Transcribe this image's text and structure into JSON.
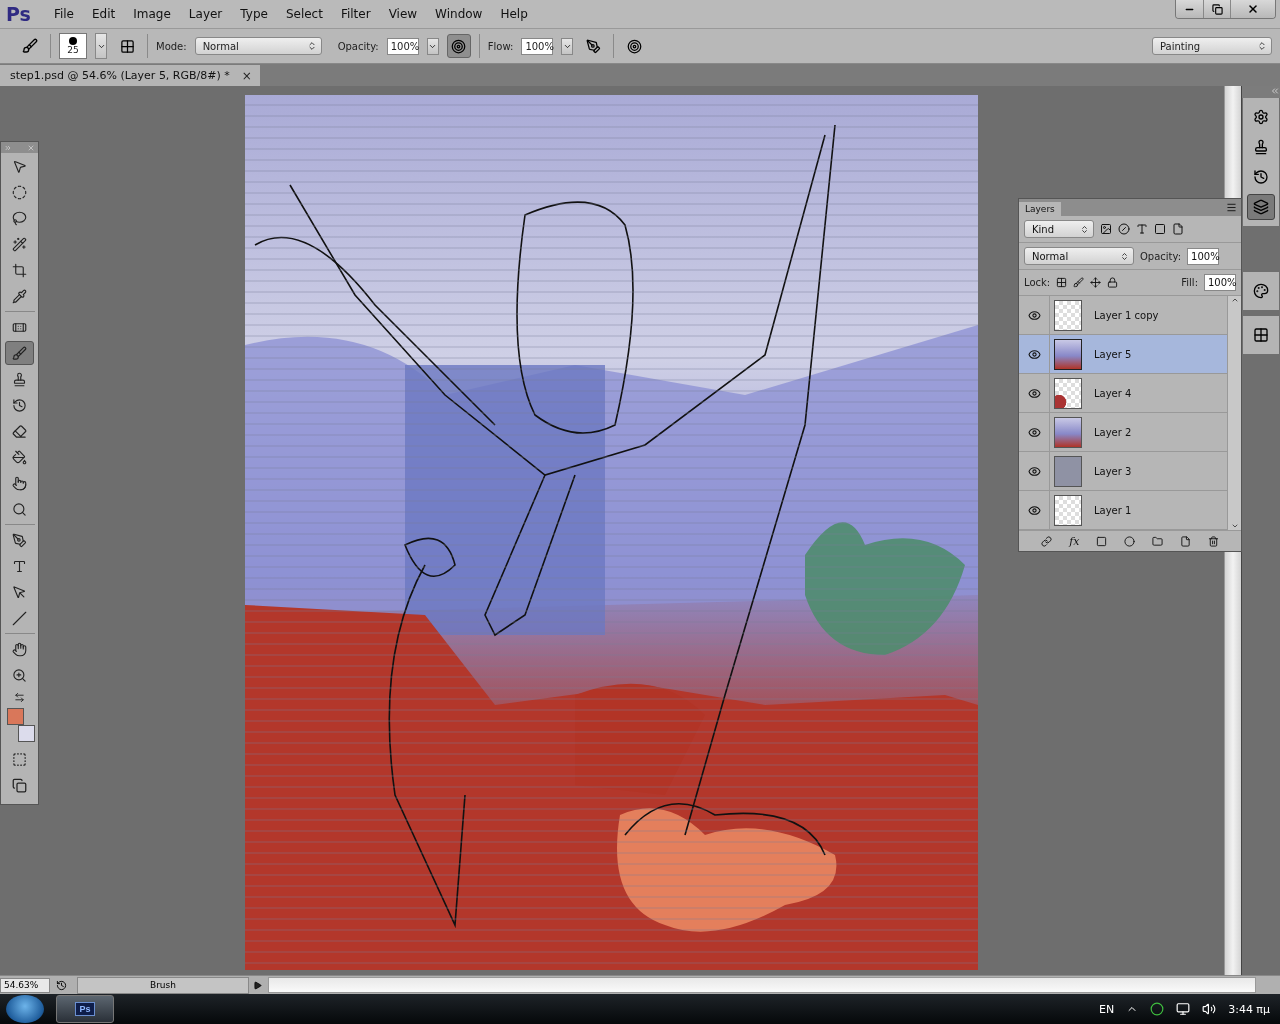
{
  "app": {
    "logo": "Ps"
  },
  "menu": [
    "File",
    "Edit",
    "Image",
    "Layer",
    "Type",
    "Select",
    "Filter",
    "View",
    "Window",
    "Help"
  ],
  "options_bar": {
    "brush_size": "25",
    "mode_label": "Mode:",
    "mode": "Normal",
    "opacity_label": "Opacity:",
    "opacity": "100%",
    "airbrush_on": true,
    "flow_label": "Flow:",
    "flow": "100%",
    "workspace": "Painting"
  },
  "document_tab": {
    "title": "step1.psd @ 54.6% (Layer 5, RGB/8#) *",
    "close": "×"
  },
  "tool_groups": [
    [
      {
        "kind": "move",
        "selected": false
      },
      {
        "kind": "marquee",
        "selected": false
      },
      {
        "kind": "lasso",
        "selected": false
      },
      {
        "kind": "wand",
        "selected": false
      },
      {
        "kind": "crop",
        "selected": false
      },
      {
        "kind": "eyedropper",
        "selected": false
      }
    ],
    [
      {
        "kind": "healing",
        "selected": false
      },
      {
        "kind": "brush",
        "selected": true
      },
      {
        "kind": "stamp",
        "selected": false
      },
      {
        "kind": "history",
        "selected": false
      },
      {
        "kind": "eraser",
        "selected": false
      },
      {
        "kind": "bucket",
        "selected": false
      },
      {
        "kind": "smudge",
        "selected": false
      },
      {
        "kind": "dodge",
        "selected": false
      }
    ],
    [
      {
        "kind": "pen",
        "selected": false
      },
      {
        "kind": "type",
        "selected": false
      },
      {
        "kind": "path",
        "selected": false
      },
      {
        "kind": "line",
        "selected": false
      }
    ],
    [
      {
        "kind": "hand",
        "selected": false
      },
      {
        "kind": "zoom",
        "selected": false
      }
    ]
  ],
  "layers_panel": {
    "title": "Layers",
    "filter": "Kind",
    "blend_mode": "Normal",
    "opacity_label": "Opacity:",
    "opacity": "100%",
    "lock_label": "Lock:",
    "fill_label": "Fill:",
    "fill": "100%",
    "fx": "fx",
    "layers": [
      {
        "name": "Layer 1 copy",
        "visible": true,
        "selected": false,
        "kind": "transparent"
      },
      {
        "name": "Layer 5",
        "visible": true,
        "selected": true,
        "kind": "painting"
      },
      {
        "name": "Layer 4",
        "visible": true,
        "selected": false,
        "kind": "stroke"
      },
      {
        "name": "Layer 2",
        "visible": true,
        "selected": false,
        "kind": "painting"
      },
      {
        "name": "Layer 3",
        "visible": true,
        "selected": false,
        "kind": "solid"
      },
      {
        "name": "Layer 1",
        "visible": true,
        "selected": false,
        "kind": "transparent"
      }
    ]
  },
  "status_bar": {
    "zoom": "54.63%",
    "info": "Brush"
  },
  "taskbar": {
    "app_icon": "Ps",
    "language": "EN",
    "time": "3:44 πμ"
  }
}
